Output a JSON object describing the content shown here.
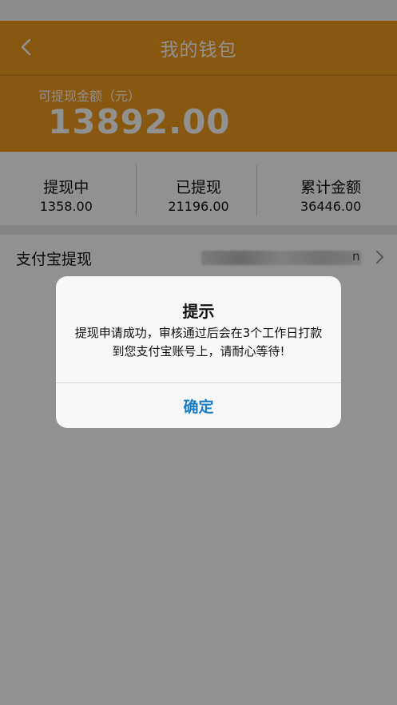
{
  "nav": {
    "title": "我的钱包",
    "back_icon": "chevron-left-icon"
  },
  "balance": {
    "label": "可提现金额（元）",
    "amount": "13892.00"
  },
  "stats": [
    {
      "title": "提现中",
      "value": "1358.00"
    },
    {
      "title": "已提现",
      "value": "21196.00"
    },
    {
      "title": "累计金额",
      "value": "36446.00"
    }
  ],
  "alipay": {
    "label": "支付宝提现",
    "account_suffix": "n",
    "chevron_icon": "chevron-right-icon"
  },
  "dialog": {
    "title": "提示",
    "message": "提现申请成功，审核通过后会在3个工作日打款到您支付宝账号上，请耐心等待!",
    "ok_label": "确定"
  },
  "colors": {
    "brand": "#ef9a1d",
    "link": "#1b7cc4"
  }
}
